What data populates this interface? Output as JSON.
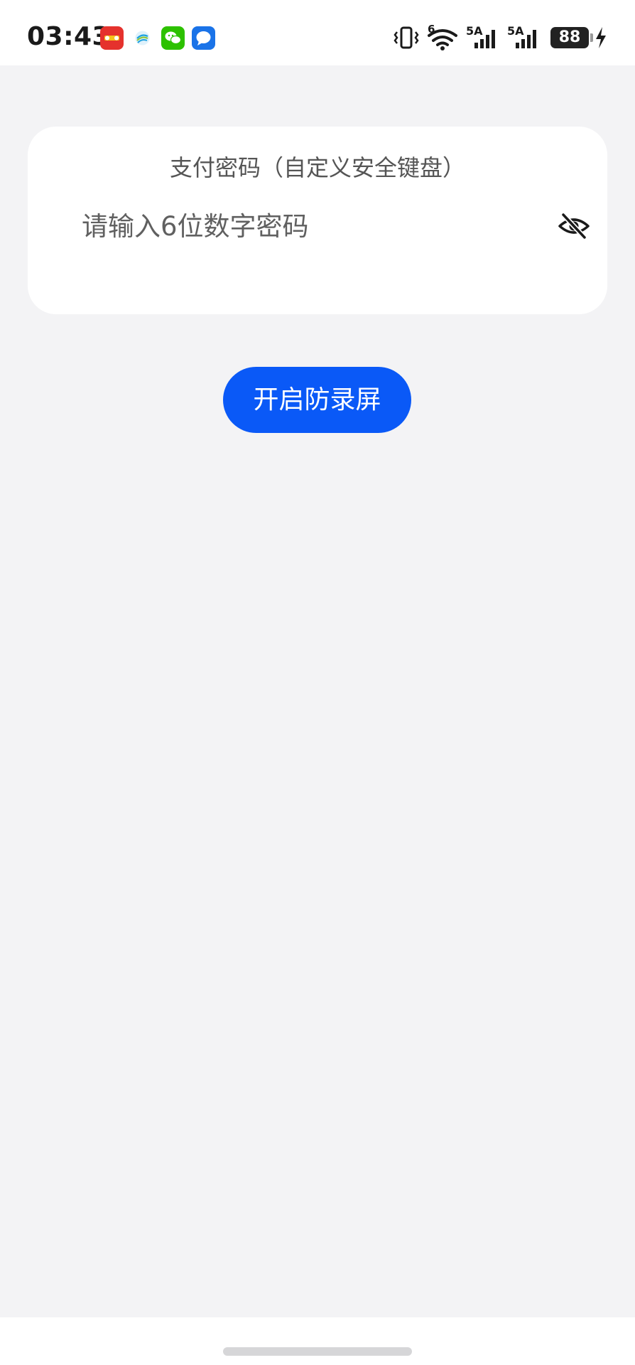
{
  "status_bar": {
    "time": "03:43",
    "notification_icons": [
      "redbull-app-icon",
      "china-mobile-icon",
      "wechat-icon",
      "messages-icon"
    ],
    "right_icons": [
      "vibrate-icon",
      "wifi-icon",
      "signal-icon",
      "signal-icon",
      "battery-icon",
      "charging-icon"
    ],
    "wifi_label": "6",
    "sim1_label": "5A",
    "sim2_label": "5A",
    "battery_level": "88"
  },
  "card": {
    "title": "支付密码（自定义安全键盘）",
    "input_placeholder": "请输入6位数字密码",
    "input_value": "",
    "toggle_icon": "eye-off-icon"
  },
  "button": {
    "label": "开启防录屏"
  },
  "colors": {
    "background": "#f3f3f5",
    "card": "#ffffff",
    "accent": "#0a59f7",
    "title_text": "#555555",
    "placeholder_text": "#606060"
  }
}
